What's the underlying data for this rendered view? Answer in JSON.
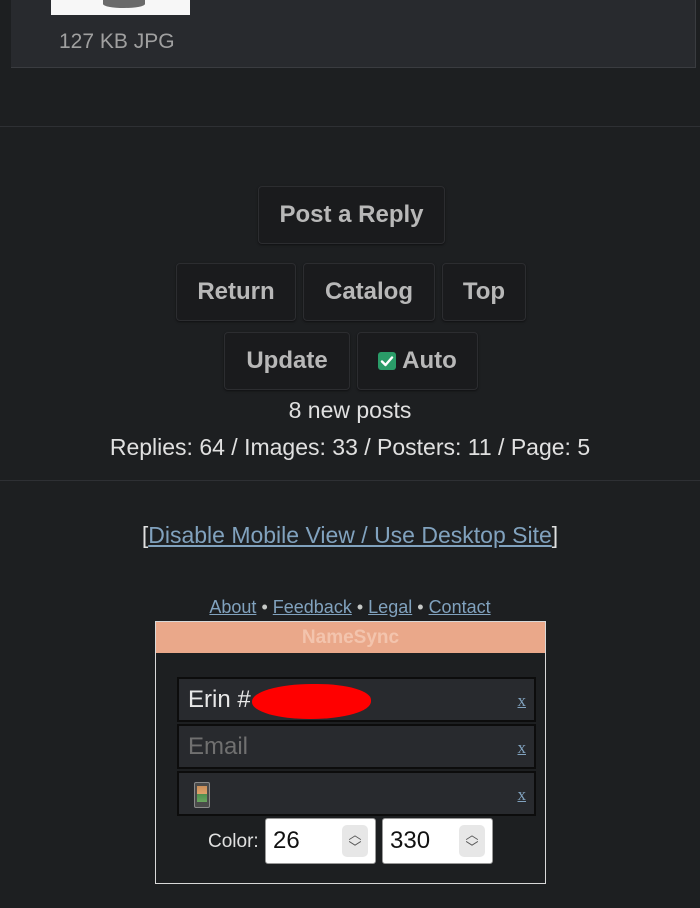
{
  "post": {
    "file_info": "127 KB JPG"
  },
  "buttons": {
    "post_reply": "Post a Reply",
    "return": "Return",
    "catalog": "Catalog",
    "top": "Top",
    "update": "Update",
    "auto": "Auto",
    "auto_checked": true
  },
  "status": {
    "new_posts": "8 new posts",
    "stats": "Replies: 64 / Images: 33 / Posters: 11 / Page: 5"
  },
  "mobile": {
    "bracket_open": "[",
    "link": "Disable Mobile View / Use Desktop Site",
    "bracket_close": "]"
  },
  "footer": {
    "links": [
      "About",
      "Feedback",
      "Legal",
      "Contact"
    ],
    "separator": "•"
  },
  "namesync": {
    "title": "NameSync",
    "name_value": "Erin #",
    "email_placeholder": "Email",
    "clear_label": "x",
    "color_label": "Color:",
    "color_value_1": "26",
    "color_value_2": "330"
  },
  "colors": {
    "background": "#1d1f21",
    "link": "#81a2be",
    "namesync_header": "#eaa88a",
    "checkbox": "#2a9c68",
    "redaction": "#ff0000"
  }
}
